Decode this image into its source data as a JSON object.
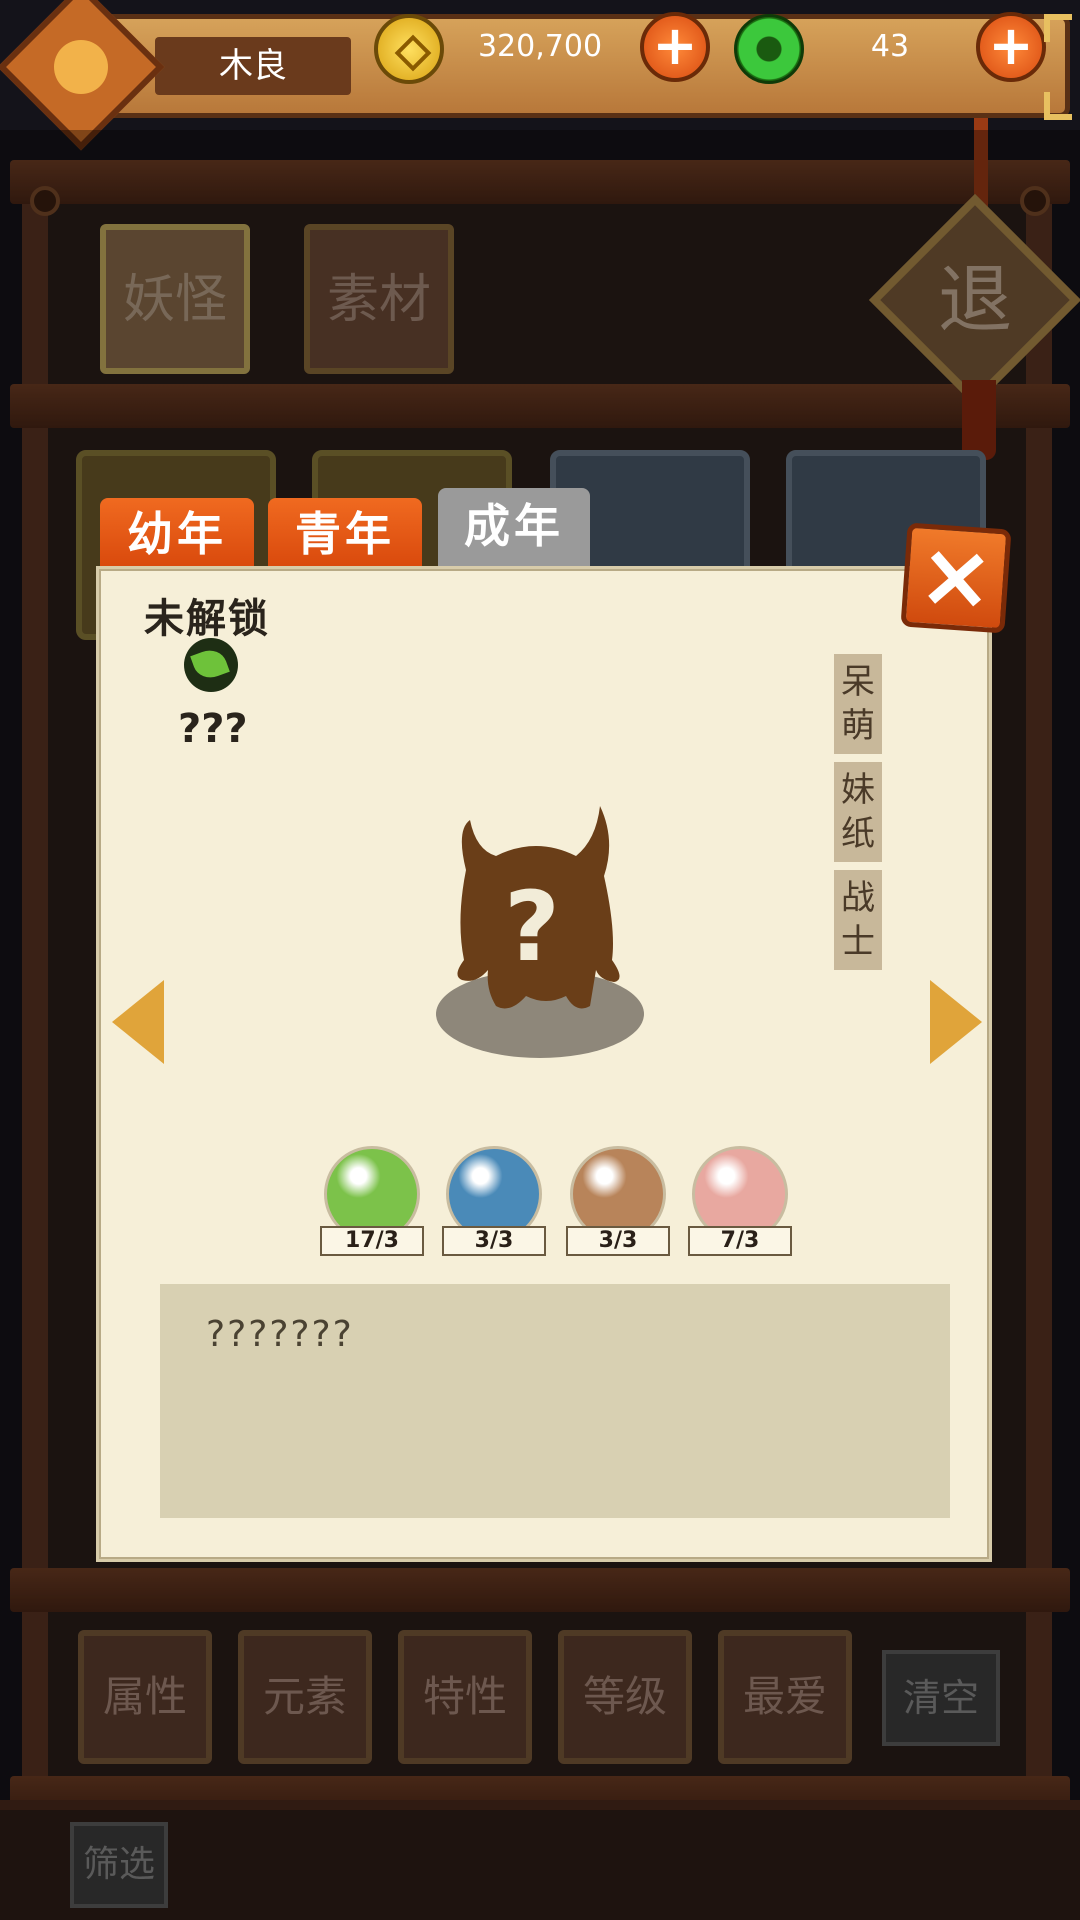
{
  "header": {
    "player_name": "木良",
    "coins": "320,700",
    "jade": "43"
  },
  "categories": {
    "monster": "妖怪",
    "material": "素材",
    "exit": "退"
  },
  "tabs": [
    {
      "label": "幼年",
      "state": "inactive"
    },
    {
      "label": "青年",
      "state": "inactive"
    },
    {
      "label": "成年",
      "state": "selected"
    }
  ],
  "detail": {
    "status": "未解锁",
    "name": "???",
    "element_icon": "leaf-icon",
    "traits": [
      "呆萌",
      "妹纸",
      "战士"
    ],
    "materials": [
      {
        "icon": "bamboo-material-icon",
        "count": "17",
        "need": "3",
        "color": "#7cc24a"
      },
      {
        "icon": "ice-eye-material-icon",
        "count": "3",
        "need": "3",
        "color": "#4a8ab8"
      },
      {
        "icon": "wood-heart-material-icon",
        "count": "3",
        "need": "3",
        "color": "#b8845a"
      },
      {
        "icon": "lotus-material-icon",
        "count": "7",
        "need": "3",
        "color": "#e8a8a0"
      }
    ],
    "description": "???????"
  },
  "sort_buttons": [
    "属性",
    "元素",
    "特性",
    "等级",
    "最爱"
  ],
  "clear_label": "清空",
  "filter_label": "筛选",
  "colors": {
    "accent": "#e8561a",
    "parchment": "#f6efd8",
    "wood": "#5a3322"
  }
}
